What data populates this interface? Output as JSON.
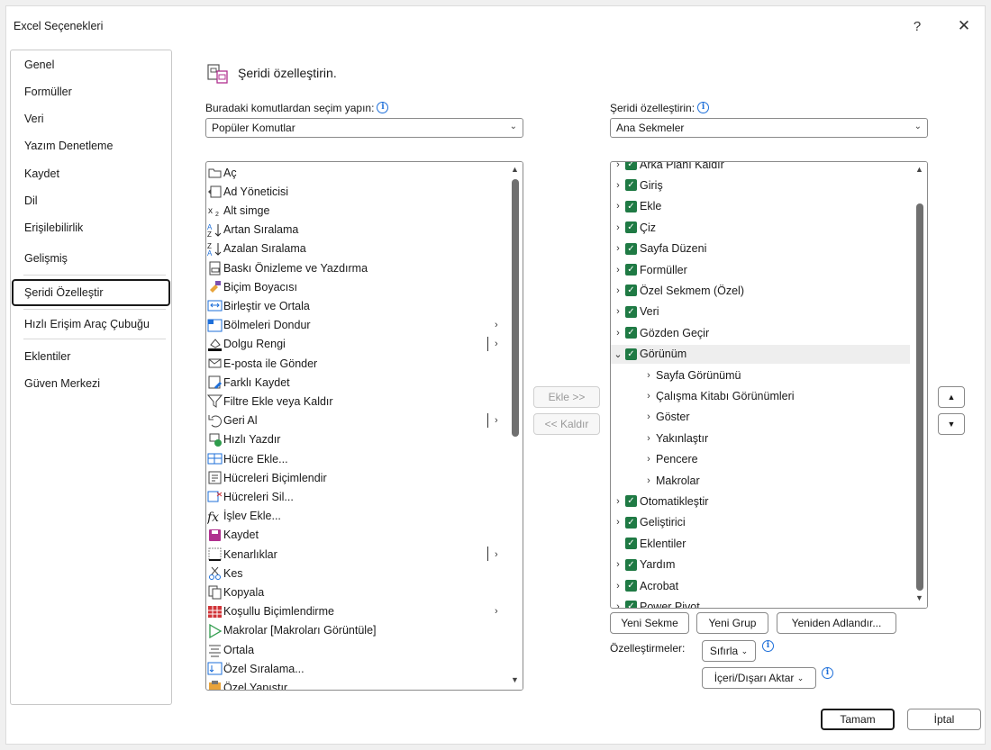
{
  "window": {
    "title": "Excel Seçenekleri",
    "help": "?",
    "close": "✕"
  },
  "nav": {
    "items": [
      "Genel",
      "Formüller",
      "Veri",
      "Yazım Denetleme",
      "Kaydet",
      "Dil",
      "Erişilebilirlik",
      "Gelişmiş",
      "Şeridi Özelleştir",
      "Hızlı Erişim Araç Çubuğu",
      "Eklentiler",
      "Güven Merkezi"
    ],
    "selected": "Şeridi Özelleştir"
  },
  "header": {
    "title": "Şeridi özelleştirin."
  },
  "left": {
    "label": "Buradaki komutlardan seçim yapın:",
    "combo_value": "Popüler Komutlar",
    "commands": [
      {
        "label": "Aç",
        "icon": "folder-open-icon"
      },
      {
        "label": "Ad Yöneticisi",
        "icon": "name-manager-icon"
      },
      {
        "label": "Alt simge",
        "icon": "subscript-icon"
      },
      {
        "label": "Artan Sıralama",
        "icon": "sort-ascending-icon"
      },
      {
        "label": "Azalan Sıralama",
        "icon": "sort-descending-icon"
      },
      {
        "label": "Baskı Önizleme ve Yazdırma",
        "icon": "print-preview-icon"
      },
      {
        "label": "Biçim Boyacısı",
        "icon": "format-painter-icon"
      },
      {
        "label": "Birleştir ve Ortala",
        "icon": "merge-center-icon"
      },
      {
        "label": "Bölmeleri Dondur",
        "icon": "freeze-panes-icon",
        "sub": "›"
      },
      {
        "label": "Dolgu Rengi",
        "icon": "fill-color-icon",
        "sub": "|›"
      },
      {
        "label": "E-posta ile Gönder",
        "icon": "email-icon"
      },
      {
        "label": "Farklı Kaydet",
        "icon": "save-as-icon"
      },
      {
        "label": "Filtre Ekle veya Kaldır",
        "icon": "filter-icon"
      },
      {
        "label": "Geri Al",
        "icon": "undo-icon",
        "sub": "|›"
      },
      {
        "label": "Hızlı Yazdır",
        "icon": "quick-print-icon"
      },
      {
        "label": "Hücre Ekle...",
        "icon": "insert-cells-icon"
      },
      {
        "label": "Hücreleri Biçimlendir",
        "icon": "format-cells-icon"
      },
      {
        "label": "Hücreleri Sil...",
        "icon": "delete-cells-icon"
      },
      {
        "label": "İşlev Ekle...",
        "icon": "insert-function-icon"
      },
      {
        "label": "Kaydet",
        "icon": "save-icon"
      },
      {
        "label": "Kenarlıklar",
        "icon": "borders-icon",
        "sub": "|›"
      },
      {
        "label": "Kes",
        "icon": "cut-icon"
      },
      {
        "label": "Kopyala",
        "icon": "copy-icon"
      },
      {
        "label": "Koşullu Biçimlendirme",
        "icon": "conditional-formatting-icon",
        "sub": "›"
      },
      {
        "label": "Makrolar [Makroları Görüntüle]",
        "icon": "macros-icon"
      },
      {
        "label": "Ortala",
        "icon": "center-icon"
      },
      {
        "label": "Özel Sıralama...",
        "icon": "custom-sort-icon"
      },
      {
        "label": "Özel Yapıştır",
        "icon": "paste-special-icon"
      }
    ]
  },
  "middle": {
    "add": "Ekle >>",
    "remove": "<< Kaldır"
  },
  "right": {
    "label": "Şeridi özelleştirin:",
    "combo_value": "Ana Sekmeler",
    "tree": [
      {
        "label": "Arka Planı Kaldır",
        "level": 0,
        "expander": "›",
        "checked": true
      },
      {
        "label": "Giriş",
        "level": 0,
        "expander": "›",
        "checked": true
      },
      {
        "label": "Ekle",
        "level": 0,
        "expander": "›",
        "checked": true
      },
      {
        "label": "Çiz",
        "level": 0,
        "expander": "›",
        "checked": true
      },
      {
        "label": "Sayfa Düzeni",
        "level": 0,
        "expander": "›",
        "checked": true
      },
      {
        "label": "Formüller",
        "level": 0,
        "expander": "›",
        "checked": true
      },
      {
        "label": "Özel Sekmem (Özel)",
        "level": 0,
        "expander": "›",
        "checked": true
      },
      {
        "label": "Veri",
        "level": 0,
        "expander": "›",
        "checked": true
      },
      {
        "label": "Gözden Geçir",
        "level": 0,
        "expander": "›",
        "checked": true
      },
      {
        "label": "Görünüm",
        "level": 0,
        "expander": "⌄",
        "checked": true,
        "highlight": true
      },
      {
        "label": "Sayfa Görünümü",
        "level": 1,
        "expander": "›"
      },
      {
        "label": "Çalışma Kitabı Görünümleri",
        "level": 1,
        "expander": "›"
      },
      {
        "label": "Göster",
        "level": 1,
        "expander": "›"
      },
      {
        "label": "Yakınlaştır",
        "level": 1,
        "expander": "›"
      },
      {
        "label": "Pencere",
        "level": 1,
        "expander": "›"
      },
      {
        "label": "Makrolar",
        "level": 1,
        "expander": "›"
      },
      {
        "label": "Otomatikleştir",
        "level": 0,
        "expander": "›",
        "checked": true
      },
      {
        "label": "Geliştirici",
        "level": 0,
        "expander": "›",
        "checked": true
      },
      {
        "label": "Eklentiler",
        "level": 0,
        "expander": "",
        "checked": true
      },
      {
        "label": "Yardım",
        "level": 0,
        "expander": "›",
        "checked": true
      },
      {
        "label": "Acrobat",
        "level": 0,
        "expander": "›",
        "checked": true
      },
      {
        "label": "Power Pivot",
        "level": 0,
        "expander": "›",
        "checked": true
      }
    ],
    "new_tab": "Yeni Sekme",
    "new_group": "Yeni Grup",
    "rename": "Yeniden Adlandır...",
    "customizations_label": "Özelleştirmeler:",
    "reset": "Sıfırla",
    "import_export": "İçeri/Dışarı Aktar"
  },
  "footer": {
    "ok": "Tamam",
    "cancel": "İptal"
  },
  "colors": {
    "checkbox": "#1f7a44",
    "info": "#1e6fd9"
  }
}
